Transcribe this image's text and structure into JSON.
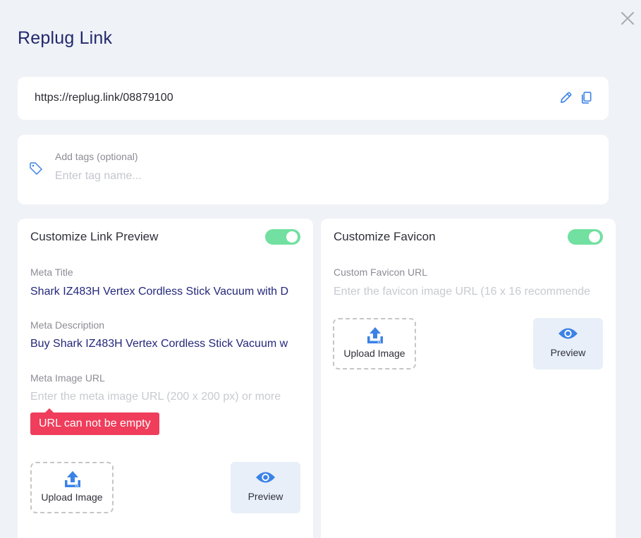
{
  "modal": {
    "title": "Replug Link",
    "close_icon": "close-icon"
  },
  "link": {
    "url": "https://replug.link/08879100",
    "edit_icon": "pencil-icon",
    "copy_icon": "copy-icon"
  },
  "tags": {
    "icon": "tag-icon",
    "label": "Add tags (optional)",
    "placeholder": "Enter tag name..."
  },
  "link_preview": {
    "title": "Customize Link Preview",
    "enabled": true,
    "meta_title_label": "Meta Title",
    "meta_title_value": "Shark IZ483H Vertex Cordless Stick Vacuum with D",
    "meta_description_label": "Meta Description",
    "meta_description_value": "Buy Shark IZ483H Vertex Cordless Stick Vacuum w",
    "meta_image_label": "Meta Image URL",
    "meta_image_placeholder": "Enter the meta image URL (200 x 200 px) or more",
    "error_message": "URL can not be empty",
    "upload_label": "Upload Image",
    "preview_label": "Preview"
  },
  "favicon": {
    "title": "Customize Favicon",
    "enabled": true,
    "url_label": "Custom Favicon URL",
    "url_placeholder": "Enter the favicon image URL (16 x 16 recommende",
    "upload_label": "Upload Image",
    "preview_label": "Preview"
  },
  "colors": {
    "accent": "#3b82e6",
    "toggle_on": "#72e0a0",
    "error": "#ef3d5b",
    "title": "#22286e"
  }
}
